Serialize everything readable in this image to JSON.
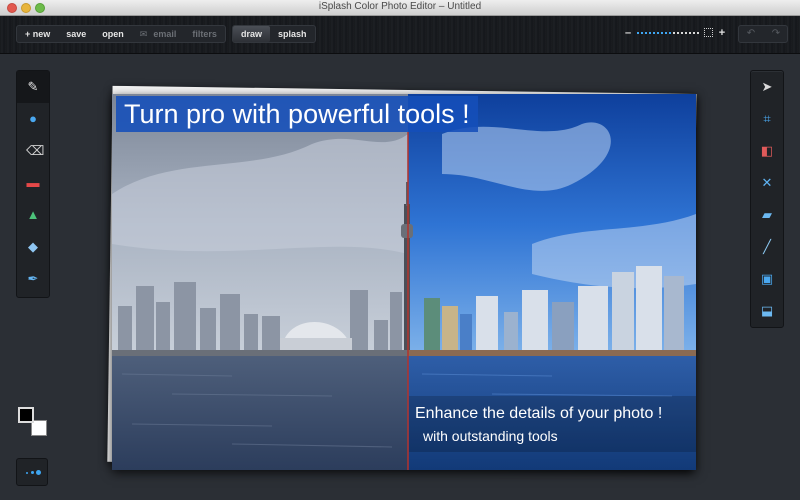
{
  "window": {
    "title": "iSplash Color Photo Editor  – Untitled"
  },
  "toolbar": {
    "new_label": "+ new",
    "save_label": "save",
    "open_label": "open",
    "email_label": "email",
    "filters_label": "filters",
    "draw_label": "draw",
    "splash_label": "splash",
    "zoom_minus": "–",
    "zoom_plus": "+",
    "zoom_level": 0.55,
    "undo_label": "↶",
    "redo_label": "↷"
  },
  "left_tools": [
    {
      "name": "brush-icon",
      "glyph": "✎",
      "color": "#e6e6e6",
      "selected": true
    },
    {
      "name": "drop-icon",
      "glyph": "●",
      "color": "#4aa8f0",
      "selected": false
    },
    {
      "name": "eraser-icon",
      "glyph": "⌫",
      "color": "#cfcfcf",
      "selected": false
    },
    {
      "name": "bandage-icon",
      "glyph": "▬",
      "color": "#e44848",
      "selected": false
    },
    {
      "name": "color-fill-icon",
      "glyph": "▲",
      "color": "#4cc27a",
      "selected": false
    },
    {
      "name": "blur-icon",
      "glyph": "◆",
      "color": "#8fc6f2",
      "selected": false
    },
    {
      "name": "pen-icon",
      "glyph": "✒",
      "color": "#64b5f2",
      "selected": false
    }
  ],
  "right_tools": [
    {
      "name": "pointer-icon",
      "glyph": "➤",
      "color": "#d9d9d9"
    },
    {
      "name": "crop-icon",
      "glyph": "⌗",
      "color": "#4aa8f0"
    },
    {
      "name": "swap-colors-icon",
      "glyph": "◧",
      "color": "#e05a5a"
    },
    {
      "name": "close-icon",
      "glyph": "✕",
      "color": "#5fb3f2"
    },
    {
      "name": "ruler-icon",
      "glyph": "▰",
      "color": "#6cb9f2"
    },
    {
      "name": "straighten-icon",
      "glyph": "╱",
      "color": "#8ccaf3"
    },
    {
      "name": "window-icon",
      "glyph": "▣",
      "color": "#4aa8f0"
    },
    {
      "name": "stamp-icon",
      "glyph": "⬓",
      "color": "#6cb9f2"
    }
  ],
  "colors": {
    "foreground": "#000000",
    "background": "#ffffff",
    "accent": "#3ea6f2"
  },
  "photo": {
    "headline": "Turn pro with powerful tools !",
    "caption_line1": "Enhance the details of your photo !",
    "caption_line2": "with outstanding tools"
  }
}
